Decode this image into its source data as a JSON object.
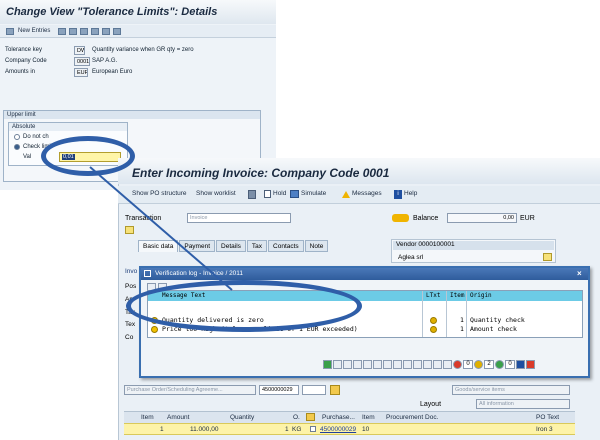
{
  "screen_a": {
    "title": "Change View \"Tolerance Limits\": Details",
    "new_entries": "New Entries",
    "tolerance_key_label": "Tolerance key",
    "tolerance_key_value": "DW",
    "tolerance_key_desc": "Quantity variance when GR qty = zero",
    "company_code_label": "Company Code",
    "company_code_value": "0001",
    "company_code_desc": "SAP A.G.",
    "amounts_in_label": "Amounts in",
    "amounts_in_value": "EUR",
    "amounts_in_desc": "European Euro",
    "upper_limit": "Upper limit",
    "absolute": "Absolute",
    "do_not_check": "Do not ch",
    "check_limit": "Check limit",
    "val_label": "Val",
    "val_value": "0,01"
  },
  "screen_b": {
    "title": "Enter Incoming Invoice: Company Code 0001",
    "toolbar": {
      "show_po_structure": "Show PO structure",
      "show_worklist": "Show worklist",
      "hold": "Hold",
      "simulate": "Simulate",
      "messages": "Messages",
      "help": "Help"
    },
    "transaction_label": "Transaction",
    "transaction_value": "Invoice",
    "balance_label": "Balance",
    "balance_value": "0,00",
    "balance_currency": "EUR",
    "tabs": [
      "Basic data",
      "Payment",
      "Details",
      "Tax",
      "Contacts",
      "Note"
    ],
    "vendor_title": "Vendor 0000100001",
    "vendor_name": "Aglea srl",
    "left_labels": [
      "Invo",
      "Pos",
      "Am",
      "Tax",
      "Tex",
      "Co"
    ],
    "po_selector": "Purchase Order/Scheduling Agreeme...",
    "po_number": "4500000029",
    "goods_items": "Goods/service items",
    "layout_label": "Layout",
    "layout_value": "All information",
    "table": {
      "headers": [
        "Item",
        "Amount",
        "Quantity",
        "O.",
        "Purchase...",
        "Item",
        "Procurement Doc.",
        "PO Text"
      ],
      "row": {
        "item": "1",
        "amount": "11.000,00",
        "quantity": "1",
        "unit": "KG",
        "po": "4500000029",
        "po_item": "10",
        "po_text": "Iron 3"
      }
    }
  },
  "popup": {
    "title": "Verification log - Invoice / 2011",
    "col_message": "Message Text",
    "col_ltxt": "LTxt",
    "col_item": "Item",
    "col_origin": "Origin",
    "rows": [
      {
        "text": "Quantity delivered is zero",
        "item": "1",
        "origin": "Quantity check"
      },
      {
        "text": "Price too high (tolerance limit of 1 EUR exceeded)",
        "item": "1",
        "origin": "Amount check"
      }
    ],
    "counts": {
      "errors": "0",
      "warnings": "2",
      "info": "0"
    }
  },
  "colors": {
    "sap_blue": "#2f5ea8",
    "header_cyan": "#6ccbe6",
    "row_yellow": "#fdf3a8"
  }
}
